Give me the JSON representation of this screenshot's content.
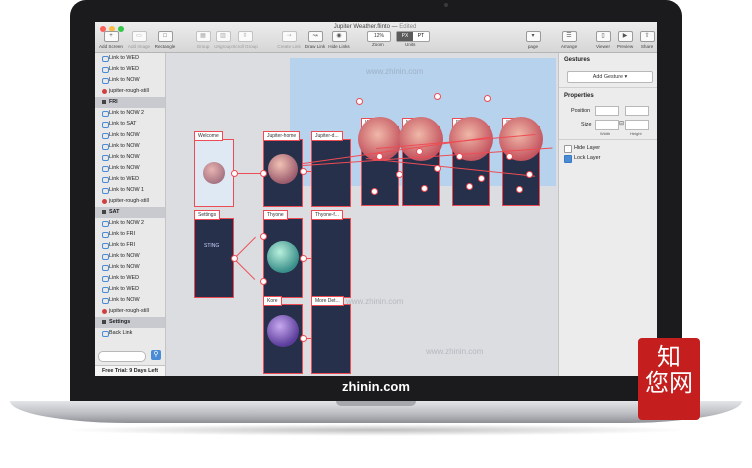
{
  "window": {
    "title": "Jupiter Weather.flinto",
    "status": "Edited"
  },
  "toolbar": {
    "add_screen": "Add Screen",
    "add_image": "Add Image",
    "rectangle": "Rectangle",
    "group": "Group",
    "ungroup": "Ungroup",
    "scroll_group": "Scroll Group",
    "create_link": "Create Link",
    "draw_link": "Draw Link",
    "hide_links": "Hide Links",
    "zoom_value": "12%",
    "zoom_label": "Zoom",
    "units_px": "PX",
    "units_pt": "PT",
    "units_label": "Units",
    "page_label": "page",
    "arrange": "Arrange",
    "viewer": "Viewer",
    "preview": "Preview",
    "share": "Share"
  },
  "sidebar": {
    "items": [
      {
        "kind": "link",
        "label": "Link to WED"
      },
      {
        "kind": "link",
        "label": "Link to WED"
      },
      {
        "kind": "link",
        "label": "Link to NOW"
      },
      {
        "kind": "artboard",
        "label": "jupiter-rough-still"
      },
      {
        "kind": "group",
        "label": "FRI"
      },
      {
        "kind": "link",
        "label": "Link to NOW 2"
      },
      {
        "kind": "link",
        "label": "Link to SAT"
      },
      {
        "kind": "link",
        "label": "Link to NOW"
      },
      {
        "kind": "link",
        "label": "Link to NOW"
      },
      {
        "kind": "link",
        "label": "Link to NOW"
      },
      {
        "kind": "link",
        "label": "Link to NOW"
      },
      {
        "kind": "link",
        "label": "Link to WED"
      },
      {
        "kind": "link",
        "label": "Link to NOW 1"
      },
      {
        "kind": "artboard",
        "label": "jupiter-rough-still"
      },
      {
        "kind": "group",
        "label": "SAT"
      },
      {
        "kind": "link",
        "label": "Link to NOW 2"
      },
      {
        "kind": "link",
        "label": "Link to FRI"
      },
      {
        "kind": "link",
        "label": "Link to FRI"
      },
      {
        "kind": "link",
        "label": "Link to NOW"
      },
      {
        "kind": "link",
        "label": "Link to NOW"
      },
      {
        "kind": "link",
        "label": "Link to WED"
      },
      {
        "kind": "link",
        "label": "Link to WED"
      },
      {
        "kind": "link",
        "label": "Link to NOW"
      },
      {
        "kind": "artboard",
        "label": "jupiter-rough-still"
      },
      {
        "kind": "group",
        "label": "Settings"
      },
      {
        "kind": "link",
        "label": "Back Link"
      }
    ],
    "trial": "Free Trial: 9 Days Left"
  },
  "canvas": {
    "screens": {
      "welcome": "Welcome",
      "jupiter_home": "Jupiter-home",
      "jupiter_d": "Jupiter-d...",
      "wow": "WOW",
      "now": "NOW",
      "fri": "FRI",
      "sat": "SAT",
      "settings": "Settings",
      "thyone": "Thyone",
      "thyone_f": "Thyone-f...",
      "kore": "Kore",
      "more_det": "More Det..."
    },
    "settings_text": "STING"
  },
  "inspector": {
    "gestures_title": "Gestures",
    "add_gesture": "Add Gesture",
    "properties_title": "Properties",
    "position_label": "Position",
    "size_label": "Size",
    "width_label": "Width",
    "height_label": "Height",
    "hide_layer": "Hide Layer",
    "lock_layer": "Lock Layer",
    "hide_layer_checked": false,
    "lock_layer_checked": true
  },
  "watermark": {
    "text": "www.zhinin.com",
    "brand": "zhinin.com",
    "seal": "知您网"
  },
  "colors": {
    "link_red": "#ee4c54",
    "accent_blue": "#4a8bd6",
    "seal_red": "#c41e1e"
  }
}
